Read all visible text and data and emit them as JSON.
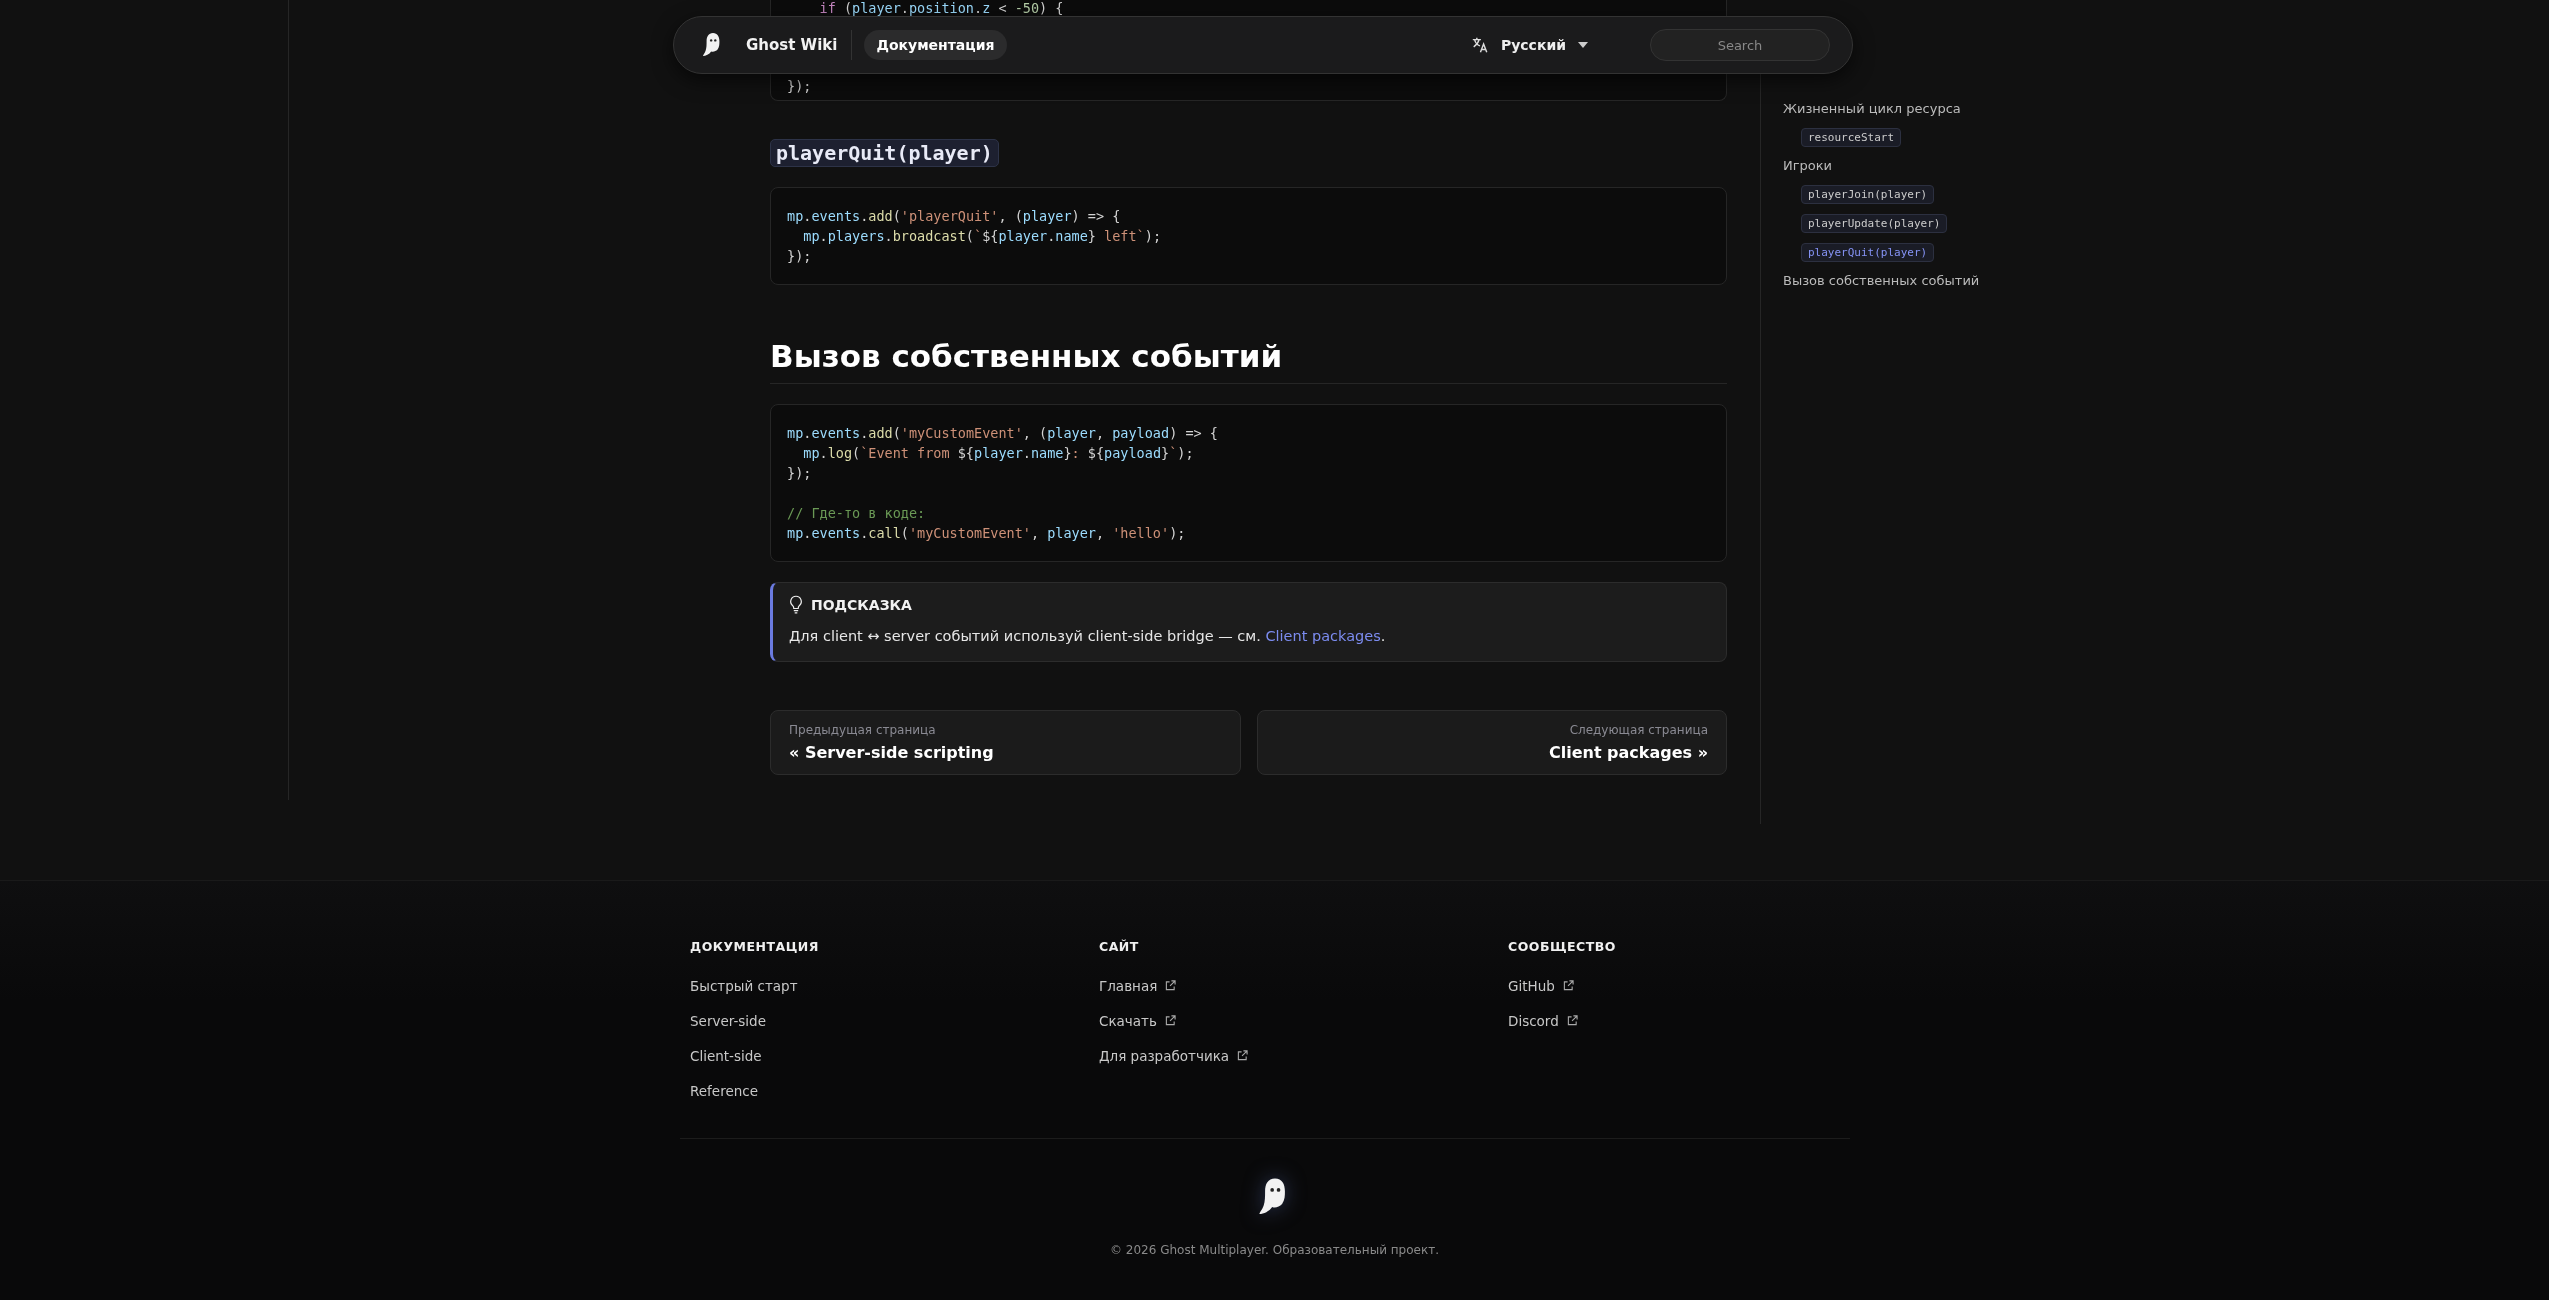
{
  "nav": {
    "brand": "Ghost Wiki",
    "links": [
      {
        "label": "Документация",
        "selected": true
      }
    ],
    "language": "Русский",
    "search": {
      "placeholder": "Search"
    }
  },
  "content": [
    {
      "kind": "code",
      "lines": [
        {
          "tokens": [
            {
              "kind": "kw",
              "text": "    if"
            },
            {
              "kind": "punct",
              "text": " ("
            },
            {
              "kind": "var",
              "text": "player"
            },
            {
              "kind": "punct",
              "text": "."
            },
            {
              "kind": "var",
              "text": "position"
            },
            {
              "kind": "punct",
              "text": "."
            },
            {
              "kind": "var",
              "text": "z"
            },
            {
              "kind": "punct",
              "text": " < "
            },
            {
              "kind": "num",
              "text": "-50"
            },
            {
              "kind": "punct",
              "text": ") {"
            }
          ]
        },
        {
          "gap_before": true,
          "tokens": [
            {
              "kind": "punct",
              "text": "});"
            }
          ]
        }
      ]
    },
    {
      "kind": "code_heading",
      "text": "playerQuit(player)"
    },
    {
      "kind": "code",
      "lines": [
        {
          "tokens": [
            {
              "kind": "var",
              "text": "mp"
            },
            {
              "kind": "punct",
              "text": "."
            },
            {
              "kind": "var",
              "text": "events"
            },
            {
              "kind": "punct",
              "text": "."
            },
            {
              "kind": "fn",
              "text": "add"
            },
            {
              "kind": "punct",
              "text": "("
            },
            {
              "kind": "str",
              "text": "'playerQuit'"
            },
            {
              "kind": "punct",
              "text": ", ("
            },
            {
              "kind": "var",
              "text": "player"
            },
            {
              "kind": "punct",
              "text": ") => {"
            }
          ]
        },
        {
          "tokens": [
            {
              "kind": "var",
              "text": "  mp"
            },
            {
              "kind": "punct",
              "text": "."
            },
            {
              "kind": "var",
              "text": "players"
            },
            {
              "kind": "punct",
              "text": "."
            },
            {
              "kind": "fn",
              "text": "broadcast"
            },
            {
              "kind": "punct",
              "text": "("
            },
            {
              "kind": "str",
              "text": "`"
            },
            {
              "kind": "punct",
              "text": "${"
            },
            {
              "kind": "var",
              "text": "player"
            },
            {
              "kind": "punct",
              "text": "."
            },
            {
              "kind": "var",
              "text": "name"
            },
            {
              "kind": "punct",
              "text": "}"
            },
            {
              "kind": "str",
              "text": " left`"
            },
            {
              "kind": "punct",
              "text": ");"
            }
          ]
        },
        {
          "tokens": [
            {
              "kind": "punct",
              "text": "});"
            }
          ]
        }
      ]
    },
    {
      "kind": "heading",
      "text": "Вызов собственных событий"
    },
    {
      "kind": "code",
      "lines": [
        {
          "tokens": [
            {
              "kind": "var",
              "text": "mp"
            },
            {
              "kind": "punct",
              "text": "."
            },
            {
              "kind": "var",
              "text": "events"
            },
            {
              "kind": "punct",
              "text": "."
            },
            {
              "kind": "fn",
              "text": "add"
            },
            {
              "kind": "punct",
              "text": "("
            },
            {
              "kind": "str",
              "text": "'myCustomEvent'"
            },
            {
              "kind": "punct",
              "text": ", ("
            },
            {
              "kind": "var",
              "text": "player"
            },
            {
              "kind": "punct",
              "text": ", "
            },
            {
              "kind": "var",
              "text": "payload"
            },
            {
              "kind": "punct",
              "text": ") => {"
            }
          ]
        },
        {
          "tokens": [
            {
              "kind": "var",
              "text": "  mp"
            },
            {
              "kind": "punct",
              "text": "."
            },
            {
              "kind": "fn",
              "text": "log"
            },
            {
              "kind": "punct",
              "text": "("
            },
            {
              "kind": "str",
              "text": "`Event from "
            },
            {
              "kind": "punct",
              "text": "${"
            },
            {
              "kind": "var",
              "text": "player"
            },
            {
              "kind": "punct",
              "text": "."
            },
            {
              "kind": "var",
              "text": "name"
            },
            {
              "kind": "punct",
              "text": "}"
            },
            {
              "kind": "str",
              "text": ": "
            },
            {
              "kind": "punct",
              "text": "${"
            },
            {
              "kind": "var",
              "text": "payload"
            },
            {
              "kind": "punct",
              "text": "}"
            },
            {
              "kind": "str",
              "text": "`"
            },
            {
              "kind": "punct",
              "text": ");"
            }
          ]
        },
        {
          "tokens": [
            {
              "kind": "punct",
              "text": "});"
            }
          ]
        },
        {
          "gap_before": true,
          "tokens": [
            {
              "kind": "comment",
              "text": "// Где-то в коде:"
            }
          ]
        },
        {
          "tokens": [
            {
              "kind": "var",
              "text": "mp"
            },
            {
              "kind": "punct",
              "text": "."
            },
            {
              "kind": "var",
              "text": "events"
            },
            {
              "kind": "punct",
              "text": "."
            },
            {
              "kind": "fn",
              "text": "call"
            },
            {
              "kind": "punct",
              "text": "("
            },
            {
              "kind": "str",
              "text": "'myCustomEvent'"
            },
            {
              "kind": "punct",
              "text": ", "
            },
            {
              "kind": "var",
              "text": "player"
            },
            {
              "kind": "punct",
              "text": ", "
            },
            {
              "kind": "str",
              "text": "'hello'"
            },
            {
              "kind": "punct",
              "text": ");"
            }
          ]
        }
      ]
    },
    {
      "kind": "tip",
      "title": "ПОДСКАЗКА",
      "text_before": "Для client ↔ server событий используй client-side bridge — см.",
      "link": "Client packages",
      "text_after": "."
    }
  ],
  "pager": {
    "previous": {
      "label": "Предыдущая страница",
      "title": "« Server-side scripting"
    },
    "next": {
      "label": "Следующая страница",
      "title": "Client packages »"
    }
  },
  "toc": [
    {
      "label": "Жизненный цикл ресурса",
      "selected": false,
      "children": [
        {
          "label": "resourceStart",
          "selected": false
        }
      ]
    },
    {
      "label": "Игроки",
      "selected": false,
      "children": [
        {
          "label": "playerJoin(player)",
          "selected": false
        },
        {
          "label": "playerUpdate(player)",
          "selected": false
        },
        {
          "label": "playerQuit(player)",
          "selected": true
        }
      ]
    },
    {
      "label": "Вызов собственных событий",
      "selected": false
    }
  ],
  "footer": {
    "columns": [
      {
        "title": "ДОКУМЕНТАЦИЯ",
        "links": [
          {
            "label": "Быстрый старт",
            "external": false
          },
          {
            "label": "Server-side",
            "external": false
          },
          {
            "label": "Client-side",
            "external": false
          },
          {
            "label": "Reference",
            "external": false
          }
        ]
      },
      {
        "title": "САЙТ",
        "links": [
          {
            "label": "Главная",
            "external": true
          },
          {
            "label": "Скачать",
            "external": true
          },
          {
            "label": "Для разработчика",
            "external": true
          }
        ]
      },
      {
        "title": "СООБЩЕСТВО",
        "links": [
          {
            "label": "GitHub",
            "external": true
          },
          {
            "label": "Discord",
            "external": true
          }
        ]
      }
    ],
    "copyright": "© 2026 Ghost Multiplayer. Образовательный проект."
  }
}
